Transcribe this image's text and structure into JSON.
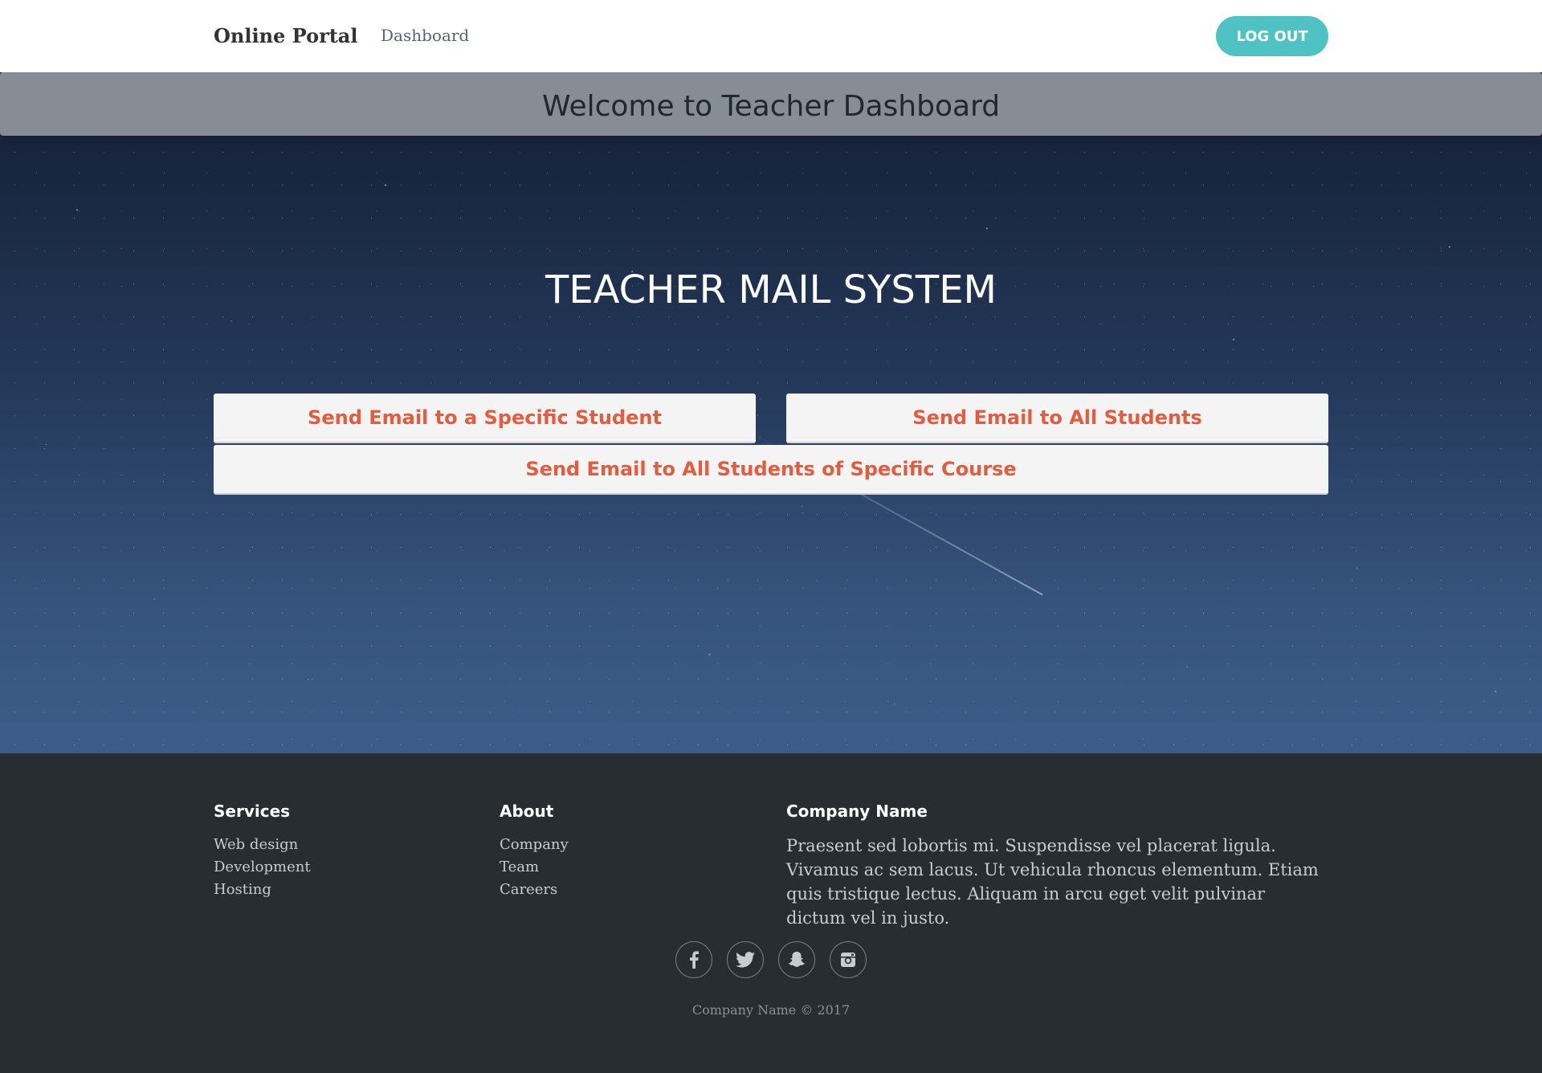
{
  "navbar": {
    "brand": "Online Portal",
    "nav_link": "Dashboard",
    "logout_label": "LOG OUT"
  },
  "welcome": {
    "title": "Welcome to Teacher Dashboard"
  },
  "hero": {
    "title": "TEACHER MAIL SYSTEM",
    "buttons": {
      "specific_student": "Send Email to a Specific Student",
      "all_students": "Send Email to All Students",
      "specific_course": "Send Email to All Students of Specific Course"
    }
  },
  "footer": {
    "services": {
      "title": "Services",
      "items": [
        "Web design",
        "Development",
        "Hosting"
      ]
    },
    "about": {
      "title": "About",
      "items": [
        "Company",
        "Team",
        "Careers"
      ]
    },
    "company": {
      "title": "Company Name",
      "text": "Praesent sed lobortis mi. Suspendisse vel placerat ligula. Vivamus ac sem lacus. Ut vehicula rhoncus elementum. Etiam quis tristique lectus. Aliquam in arcu eget velit pulvinar dictum vel in justo."
    },
    "social": [
      "facebook-icon",
      "twitter-icon",
      "snapchat-icon",
      "instagram-icon"
    ],
    "copyright": "Company Name © 2017"
  },
  "colors": {
    "accent": "#4fc3c3",
    "button_text": "#e55b3c",
    "welcome_bar": "#868d94",
    "footer_bg": "#282d32"
  }
}
